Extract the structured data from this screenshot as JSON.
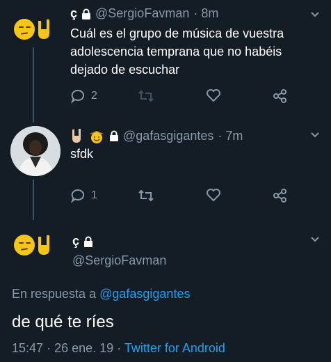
{
  "tweets": [
    {
      "name_glyph": "ç",
      "handle": "@SergioFavman",
      "time": "· 8m",
      "text": "Cuál es el grupo de música de vuestra adolescencia temprana que no habéis dejado de escuchar",
      "reply_count": "2",
      "retweet_count": "",
      "like_count": ""
    },
    {
      "handle": "@gafasgigantes",
      "time": "· 7m",
      "text": "sfdk",
      "reply_count": "1",
      "retweet_count": "",
      "like_count": ""
    }
  ],
  "main_tweet": {
    "name_glyph": "ç",
    "handle": "@SergioFavman",
    "reply_to_prefix": "En respuesta a",
    "reply_to_handle": "@gafasgigantes",
    "text": "de qué te ríes",
    "time": "15:47",
    "date": "26 ene. 19",
    "separator": "·",
    "source": "Twitter for Android"
  },
  "icons": {
    "lock": "lock-icon",
    "reply": "reply-icon",
    "retweet": "retweet-icon",
    "like": "heart-icon",
    "share": "share-icon",
    "more": "chevron-down-icon"
  },
  "colors": {
    "background": "#141d26",
    "muted": "#8899a6",
    "link": "#1da1f2"
  }
}
